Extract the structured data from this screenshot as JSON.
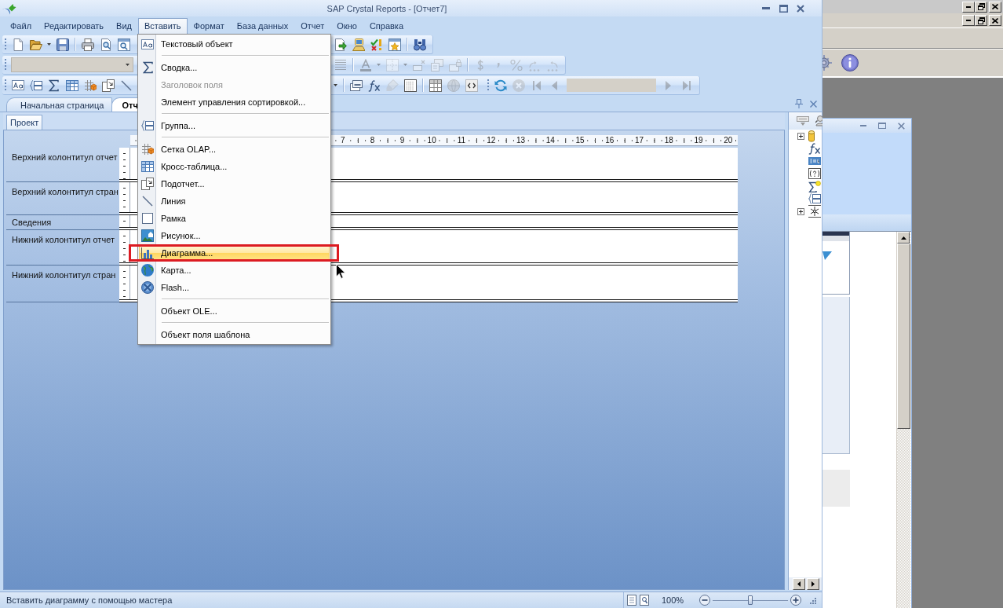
{
  "window": {
    "title": "SAP Crystal Reports - [Отчет7]"
  },
  "menu_bar": [
    {
      "label": "Файл",
      "selected": false
    },
    {
      "label": "Редактировать",
      "selected": false
    },
    {
      "label": "Вид",
      "selected": false
    },
    {
      "label": "Вставить",
      "selected": true
    },
    {
      "label": "Формат",
      "selected": false
    },
    {
      "label": "База данных",
      "selected": false
    },
    {
      "label": "Отчет",
      "selected": false
    },
    {
      "label": "Окно",
      "selected": false
    },
    {
      "label": "Справка",
      "selected": false
    }
  ],
  "insert_menu": {
    "items": [
      {
        "kind": "item",
        "label": "Текстовый объект",
        "disabled": false,
        "selected": false,
        "framed": false
      },
      {
        "kind": "separator"
      },
      {
        "kind": "item",
        "label": "Сводка...",
        "disabled": false,
        "selected": false,
        "framed": false
      },
      {
        "kind": "item",
        "label": "Заголовок поля",
        "disabled": true,
        "selected": false,
        "framed": false
      },
      {
        "kind": "item",
        "label": "Элемент управления сортировкой...",
        "disabled": false,
        "selected": false,
        "framed": false
      },
      {
        "kind": "separator"
      },
      {
        "kind": "item",
        "label": "Группа...",
        "disabled": false,
        "selected": false,
        "framed": false
      },
      {
        "kind": "separator"
      },
      {
        "kind": "item",
        "label": "Сетка OLAP...",
        "disabled": false,
        "selected": false,
        "framed": false
      },
      {
        "kind": "item",
        "label": "Кросс-таблица...",
        "disabled": false,
        "selected": false,
        "framed": false
      },
      {
        "kind": "item",
        "label": "Подотчет...",
        "disabled": false,
        "selected": false,
        "framed": false
      },
      {
        "kind": "item",
        "label": "Линия",
        "disabled": false,
        "selected": false,
        "framed": false
      },
      {
        "kind": "item",
        "label": "Рамка",
        "disabled": false,
        "selected": false,
        "framed": false
      },
      {
        "kind": "item",
        "label": "Рисунок...",
        "disabled": false,
        "selected": false,
        "framed": false
      },
      {
        "kind": "item",
        "label": "Диаграмма...",
        "disabled": false,
        "selected": true,
        "framed": true
      },
      {
        "kind": "item",
        "label": "Карта...",
        "disabled": false,
        "selected": false,
        "framed": false
      },
      {
        "kind": "item",
        "label": "Flash...",
        "disabled": false,
        "selected": false,
        "framed": false
      },
      {
        "kind": "separator"
      },
      {
        "kind": "item",
        "label": "Объект OLE...",
        "disabled": false,
        "selected": false,
        "framed": false
      },
      {
        "kind": "separator"
      },
      {
        "kind": "item",
        "label": "Объект поля шаблона",
        "disabled": false,
        "selected": false,
        "framed": false
      }
    ]
  },
  "toolbars": [
    {
      "left": [
        {
          "kind": "button",
          "disabled": false
        },
        {
          "kind": "button",
          "disabled": false
        },
        {
          "kind": "dropdown",
          "disabled": false
        },
        {
          "kind": "button",
          "disabled": false
        },
        {
          "kind": "separator"
        },
        {
          "kind": "button",
          "disabled": false
        },
        {
          "kind": "button",
          "disabled": false
        },
        {
          "kind": "button",
          "disabled": false
        }
      ],
      "right": [
        {
          "kind": "button",
          "disabled": false
        },
        {
          "kind": "button",
          "disabled": false
        },
        {
          "kind": "button",
          "disabled": false
        },
        {
          "kind": "button",
          "disabled": false
        },
        {
          "kind": "separator"
        },
        {
          "kind": "button",
          "disabled": false
        }
      ]
    },
    {
      "left": [
        {
          "kind": "combo",
          "disabled": true
        }
      ],
      "right": [
        {
          "kind": "button",
          "disabled": true
        },
        {
          "kind": "separator"
        },
        {
          "kind": "button",
          "disabled": true
        },
        {
          "kind": "dropdown",
          "disabled": true
        },
        {
          "kind": "button",
          "disabled": true
        },
        {
          "kind": "dropdown",
          "disabled": true
        },
        {
          "kind": "button",
          "disabled": true
        },
        {
          "kind": "button",
          "disabled": true
        },
        {
          "kind": "button",
          "disabled": true
        },
        {
          "kind": "separator"
        },
        {
          "kind": "button",
          "disabled": true
        },
        {
          "kind": "button",
          "disabled": true
        },
        {
          "kind": "button",
          "disabled": true
        },
        {
          "kind": "button",
          "disabled": true
        },
        {
          "kind": "button",
          "disabled": true
        }
      ]
    },
    {
      "left": [
        {
          "kind": "button",
          "disabled": false
        },
        {
          "kind": "button",
          "disabled": false
        },
        {
          "kind": "button",
          "disabled": false
        },
        {
          "kind": "button",
          "disabled": false
        },
        {
          "kind": "button",
          "disabled": false
        },
        {
          "kind": "button",
          "disabled": false
        },
        {
          "kind": "button",
          "disabled": false
        }
      ],
      "right": [
        {
          "kind": "dropdown",
          "disabled": false
        },
        {
          "kind": "separator"
        },
        {
          "kind": "button",
          "disabled": false
        },
        {
          "kind": "button",
          "disabled": false
        },
        {
          "kind": "button",
          "disabled": true
        },
        {
          "kind": "button",
          "disabled": false
        },
        {
          "kind": "separator"
        },
        {
          "kind": "button",
          "disabled": false
        },
        {
          "kind": "button",
          "disabled": true
        },
        {
          "kind": "button",
          "disabled": false
        },
        {
          "kind": "grip"
        },
        {
          "kind": "button",
          "disabled": false
        },
        {
          "kind": "button",
          "disabled": true
        },
        {
          "kind": "button",
          "disabled": true
        },
        {
          "kind": "button",
          "disabled": true
        },
        {
          "kind": "field",
          "disabled": true
        },
        {
          "kind": "button",
          "disabled": true
        },
        {
          "kind": "button",
          "disabled": true
        }
      ]
    }
  ],
  "document_tabs": [
    {
      "label": "Начальная страница",
      "selected": false
    },
    {
      "label": "Отч",
      "selected": true
    }
  ],
  "design": {
    "tabs": [
      {
        "label": "Проект",
        "selected": true
      }
    ],
    "ruler_labels": [
      "7",
      "8",
      "9",
      "10",
      "11",
      "12",
      "13",
      "14",
      "15",
      "16",
      "17",
      "18",
      "19",
      "20"
    ],
    "sections": [
      {
        "label": "Верхний колонтитул отчет"
      },
      {
        "label": "Верхний колонтитул стран"
      },
      {
        "label": "Сведения"
      },
      {
        "label": "Нижний колонтитул отчет"
      },
      {
        "label": "Нижний колонтитул стран"
      }
    ]
  },
  "field_explorer": {
    "nodes": [
      {
        "expander": true,
        "expanded": false
      },
      {
        "expander": false
      },
      {
        "expander": false
      },
      {
        "expander": false
      },
      {
        "expander": false
      },
      {
        "expander": false
      },
      {
        "expander": true,
        "expanded": false
      }
    ]
  },
  "status_bar": {
    "text": "Вставить диаграмму с помощью мастера",
    "zoom": "100%",
    "zoom_slider": {
      "level": 0.5
    }
  }
}
